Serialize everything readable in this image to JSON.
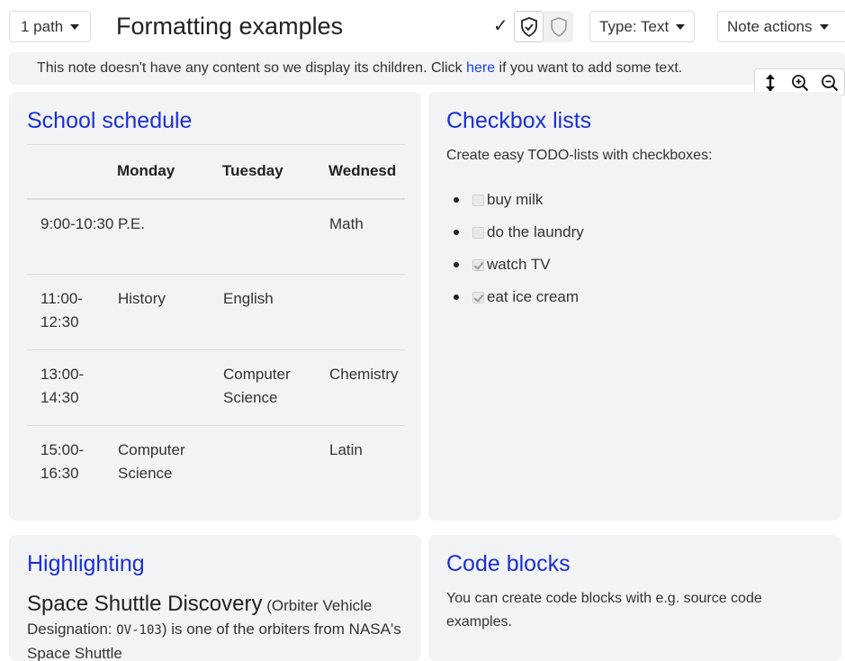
{
  "header": {
    "path_label": "1 path",
    "title": "Formatting examples",
    "type_label": "Type: Text",
    "actions_label": "Note actions"
  },
  "info_bar": {
    "before_link": "This note doesn't have any content so we display its children. Click ",
    "link": "here",
    "after_link": " if you want to add some text."
  },
  "cards": {
    "schedule": {
      "title": "School schedule",
      "headers": [
        "",
        "Monday",
        "Tuesday",
        "Wednesd"
      ],
      "rows": [
        [
          "9:00-10:30",
          "P.E.",
          "",
          "Math"
        ],
        [
          "11:00-12:30",
          "History",
          "English",
          ""
        ],
        [
          "13:00-14:30",
          "",
          "Computer Science",
          "Chemistry"
        ],
        [
          "15:00-16:30",
          "Computer Science",
          "",
          "Latin"
        ]
      ]
    },
    "checkbox": {
      "title": "Checkbox lists",
      "intro": "Create easy TODO-lists with checkboxes:",
      "items": [
        {
          "label": "buy milk",
          "checked": false
        },
        {
          "label": "do the laundry",
          "checked": false
        },
        {
          "label": "watch TV",
          "checked": true
        },
        {
          "label": "eat ice cream",
          "checked": true
        }
      ]
    },
    "highlighting": {
      "title": "Highlighting",
      "name": "Space Shuttle Discovery",
      "paren_open": " (Orbiter Vehicle Designation: ",
      "code": "OV-103",
      "rest": ") is one of the orbiters from NASA's Space Shuttle"
    },
    "code": {
      "title": "Code blocks",
      "intro": "You can create code blocks with e.g. source code examples."
    }
  },
  "colors": {
    "accent": "#1b2fd6",
    "card_bg": "#f2f3f4"
  }
}
